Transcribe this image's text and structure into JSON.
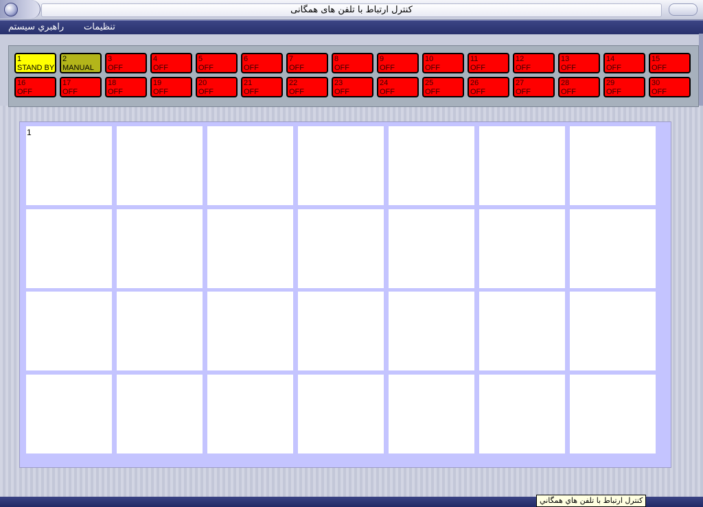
{
  "window": {
    "title": "کنترل ارتباط با تلفن های همگانی"
  },
  "menu": {
    "settings": "تنظیمات",
    "system_guide": "راهبري سيستم"
  },
  "stations": [
    {
      "num": "1",
      "status": "STAND BY",
      "state": "standby"
    },
    {
      "num": "2",
      "status": "MANUAL",
      "state": "manual"
    },
    {
      "num": "3",
      "status": "OFF",
      "state": "off"
    },
    {
      "num": "4",
      "status": "OFF",
      "state": "off"
    },
    {
      "num": "5",
      "status": "OFF",
      "state": "off"
    },
    {
      "num": "6",
      "status": "OFF",
      "state": "off"
    },
    {
      "num": "7",
      "status": "OFF",
      "state": "off"
    },
    {
      "num": "8",
      "status": "OFF",
      "state": "off"
    },
    {
      "num": "9",
      "status": "OFF",
      "state": "off"
    },
    {
      "num": "10",
      "status": "OFF",
      "state": "off"
    },
    {
      "num": "11",
      "status": "OFF",
      "state": "off"
    },
    {
      "num": "12",
      "status": "OFF",
      "state": "off"
    },
    {
      "num": "13",
      "status": "OFF",
      "state": "off"
    },
    {
      "num": "14",
      "status": "OFF",
      "state": "off"
    },
    {
      "num": "15",
      "status": "OFF",
      "state": "off"
    },
    {
      "num": "16",
      "status": "OFF",
      "state": "off"
    },
    {
      "num": "17",
      "status": "OFF",
      "state": "off"
    },
    {
      "num": "18",
      "status": "OFF",
      "state": "off"
    },
    {
      "num": "19",
      "status": "OFF",
      "state": "off"
    },
    {
      "num": "20",
      "status": "OFF",
      "state": "off"
    },
    {
      "num": "21",
      "status": "OFF",
      "state": "off"
    },
    {
      "num": "22",
      "status": "OFF",
      "state": "off"
    },
    {
      "num": "23",
      "status": "OFF",
      "state": "off"
    },
    {
      "num": "24",
      "status": "OFF",
      "state": "off"
    },
    {
      "num": "25",
      "status": "OFF",
      "state": "off"
    },
    {
      "num": "26",
      "status": "OFF",
      "state": "off"
    },
    {
      "num": "27",
      "status": "OFF",
      "state": "off"
    },
    {
      "num": "28",
      "status": "OFF",
      "state": "off"
    },
    {
      "num": "29",
      "status": "OFF",
      "state": "off"
    },
    {
      "num": "30",
      "status": "OFF",
      "state": "off"
    }
  ],
  "grid": {
    "rows": 4,
    "cols": 7,
    "cells": [
      "1",
      "",
      "",
      "",
      "",
      "",
      "",
      "",
      "",
      "",
      "",
      "",
      "",
      "",
      "",
      "",
      "",
      "",
      "",
      "",
      "",
      "",
      "",
      "",
      "",
      "",
      "",
      ""
    ]
  },
  "statusbar": {
    "tooltip": "کنترل ارتباط با تلفن هاي همگاني"
  },
  "colors": {
    "off": "#ff0000",
    "standby": "#ffff00",
    "manual": "#b3b51a"
  }
}
